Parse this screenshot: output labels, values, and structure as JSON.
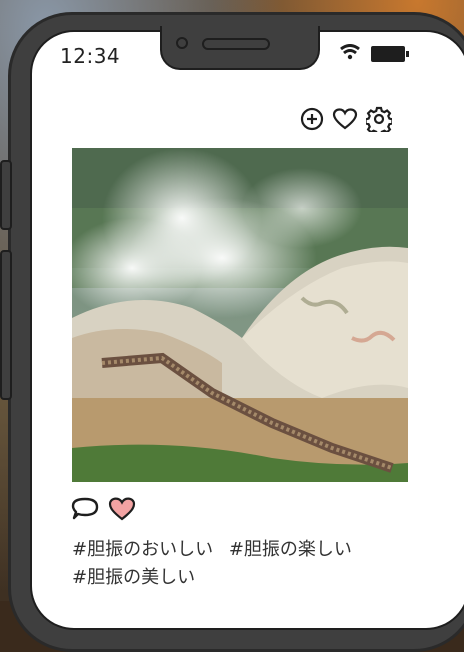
{
  "status_bar": {
    "time": "12:34"
  },
  "post": {
    "photo_description_icon": "photo",
    "tags": [
      "#胆振のおいしい",
      "#胆振の楽しい",
      "#胆振の美しい"
    ]
  },
  "colors": {
    "like_fill": "#f3a3a3",
    "frame": "#3f3f3f"
  },
  "icons": {
    "add": "add-icon",
    "like": "heart-icon",
    "settings": "gear-icon",
    "comment": "comment-icon"
  }
}
